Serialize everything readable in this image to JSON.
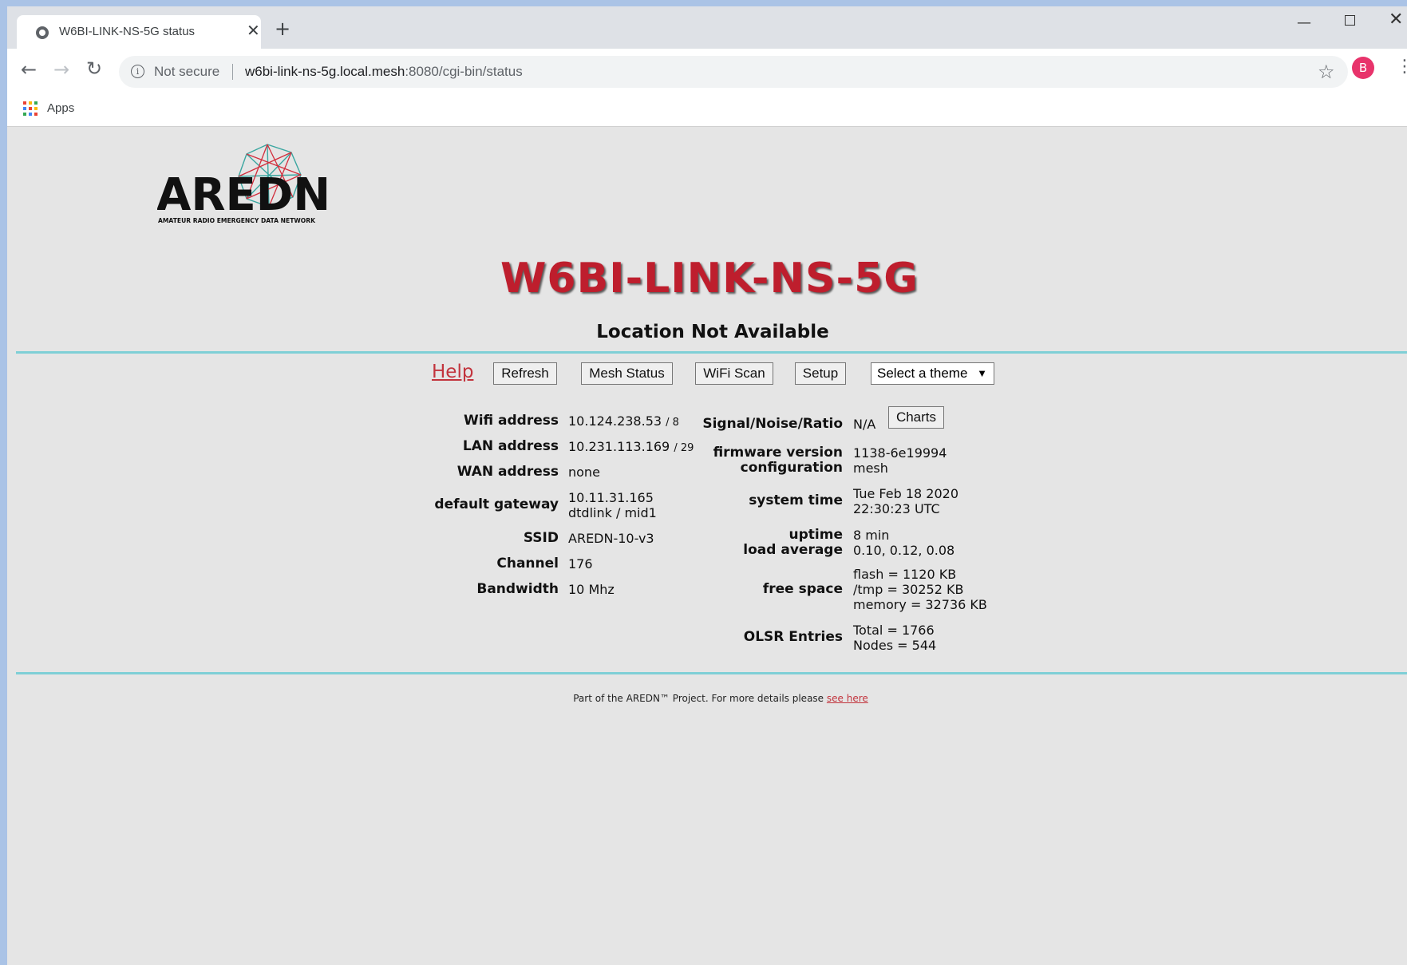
{
  "browser": {
    "tab_title": "W6BI-LINK-NS-5G status",
    "tab_close": "✕",
    "new_tab": "+",
    "security_label": "Not secure",
    "url_host": "w6bi-link-ns-5g.local.mesh",
    "url_rest": ":8080/cgi-bin/status",
    "avatar_letter": "B",
    "bookmark_apps": "Apps"
  },
  "header": {
    "node_name": "W6BI-LINK-NS-5G",
    "location": "Location Not Available",
    "logo_text": "AREDN",
    "logo_subtitle": "AMATEUR RADIO EMERGENCY DATA NETWORK"
  },
  "nav": {
    "help": "Help",
    "refresh": "Refresh",
    "mesh_status": "Mesh Status",
    "wifi_scan": "WiFi Scan",
    "setup": "Setup",
    "theme_select": "Select a theme"
  },
  "left": {
    "wifi_label": "Wifi address",
    "wifi_value": "10.124.238.53",
    "wifi_mask": "/ 8",
    "lan_label": "LAN address",
    "lan_value": "10.231.113.169",
    "lan_mask": "/ 29",
    "wan_label": "WAN address",
    "wan_value": "none",
    "gateway_label": "default gateway",
    "gateway_value_1": "10.11.31.165",
    "gateway_value_2": "dtdlink / mid1",
    "ssid_label": "SSID",
    "ssid_value": "AREDN-10-v3",
    "channel_label": "Channel",
    "channel_value": "176",
    "bandwidth_label": "Bandwidth",
    "bandwidth_value": "10 Mhz"
  },
  "right": {
    "snr_label": "Signal/Noise/Ratio",
    "snr_value": "N/A",
    "charts_button": "Charts",
    "firmware_label": "firmware version",
    "firmware_value": "1138-6e19994",
    "config_label": "configuration",
    "config_value": "mesh",
    "time_label": "system time",
    "time_value_1": "Tue Feb 18 2020",
    "time_value_2": "22:30:23 UTC",
    "uptime_label": "uptime",
    "uptime_value": "8 min",
    "load_label": "load average",
    "load_value": "0.10, 0.12, 0.08",
    "free_label": "free space",
    "free_flash": "flash = 1120 KB",
    "free_tmp": "/tmp = 30252 KB",
    "free_memory": "memory = 32736 KB",
    "olsr_label": "OLSR Entries",
    "olsr_total": "Total = 1766",
    "olsr_nodes": "Nodes = 544"
  },
  "footer": {
    "text": "Part of the AREDN™ Project. For more details please",
    "link": "see here"
  },
  "colors": {
    "accent_red": "#be1e2d",
    "rule_teal": "#7fcfd6",
    "page_bg": "#e5e5e5"
  }
}
